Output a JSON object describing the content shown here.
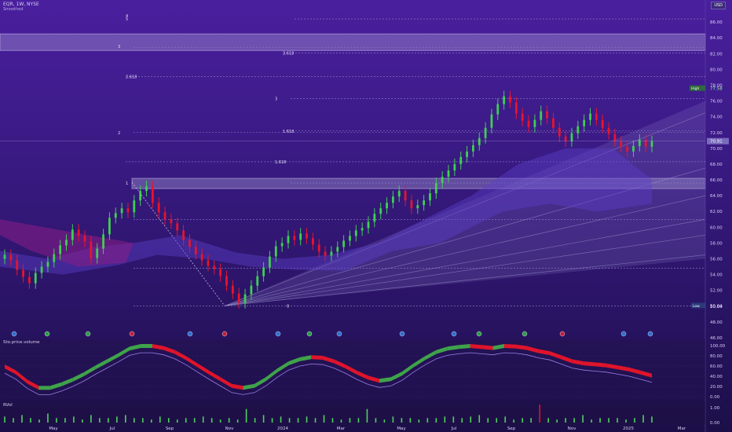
{
  "header": {
    "ticker": "EQR, 1W, NYSE",
    "subtitle": "Smoothed",
    "currency": "USD",
    "watermark": "EQR, 1W"
  },
  "colors": {
    "up": "#3fcf52",
    "down": "#e8142c",
    "neutral": "#b9b0d6",
    "fib_line": "#8f84c4",
    "gann_fan": "#a79fd1",
    "stoch_up": "#3fa34a",
    "stoch_down": "#e0142a"
  },
  "price_axis": {
    "min": 46,
    "max": 88,
    "ticks": [
      "86.00",
      "84.00",
      "82.00",
      "80.00",
      "78.00",
      "76.00",
      "74.00",
      "72.00",
      "70.00",
      "68.00",
      "66.00",
      "64.00",
      "62.00",
      "60.00",
      "58.00",
      "56.00",
      "54.00",
      "52.00",
      "50.00",
      "48.00",
      "46.00"
    ],
    "high_label": "High",
    "high_value": "77.58",
    "current_value": "70.91",
    "low_label": "Low",
    "low_value": "50.04"
  },
  "fib_levels": [
    {
      "label": "0",
      "value": 50.04
    },
    {
      "label": "1",
      "value": 65.6
    },
    {
      "label": "1.618",
      "value": 68.3
    },
    {
      "label": "2",
      "value": 72.0
    },
    {
      "label": "1.618",
      "value": 72.2
    },
    {
      "label": "2.618",
      "value": 79.1
    },
    {
      "label": "3",
      "value": 76.3
    },
    {
      "label": "3",
      "value": 82.9
    },
    {
      "label": "3.618",
      "value": 82.1
    },
    {
      "label": "4",
      "value": 86.8
    },
    {
      "label": "5",
      "value": 86.4
    }
  ],
  "supply_zones": [
    {
      "from": 82.4,
      "to": 84.5
    },
    {
      "from": 64.9,
      "to": 66.2
    }
  ],
  "x_axis": {
    "labels": [
      "May",
      "Jul",
      "Sep",
      "Nov",
      "2024",
      "Mar",
      "May",
      "Jul",
      "Sep",
      "Nov",
      "2025",
      "Mar"
    ]
  },
  "stoch": {
    "label": "Sto.price.volume",
    "ticks": [
      "100.00",
      "80.00",
      "60.00",
      "40.00",
      "20.00",
      "0.00"
    ],
    "values": [
      60,
      48,
      30,
      18,
      18,
      25,
      34,
      45,
      58,
      70,
      82,
      95,
      100,
      100,
      96,
      88,
      76,
      62,
      48,
      35,
      22,
      18,
      22,
      35,
      52,
      66,
      74,
      78,
      77,
      70,
      60,
      48,
      38,
      32,
      35,
      46,
      62,
      76,
      88,
      95,
      98,
      100,
      98,
      96,
      100,
      99,
      96,
      90,
      86,
      78,
      70,
      66,
      64,
      62,
      58,
      54,
      48,
      42
    ]
  },
  "volume": {
    "label": "RVol",
    "ticks": [
      "1.00",
      "0.00"
    ],
    "values": [
      0.4,
      0.3,
      0.5,
      0.3,
      0.2,
      0.6,
      0.3,
      0.3,
      0.4,
      0.2,
      0.5,
      0.3,
      0.3,
      0.4,
      0.5,
      0.3,
      0.3,
      0.2,
      0.4,
      0.3,
      0.2,
      0.3,
      0.3,
      0.4,
      0.3,
      0.2,
      0.3,
      0.2,
      0.9,
      0.3,
      0.5,
      0.3,
      0.4,
      0.3,
      0.3,
      0.4,
      0.3,
      0.5,
      0.3,
      0.2,
      0.3,
      0.3,
      0.9,
      0.3,
      0.2,
      0.4,
      0.3,
      0.3,
      0.2,
      0.3,
      0.3,
      0.4,
      0.4,
      0.3,
      0.4,
      0.5,
      0.3,
      0.3,
      0.4,
      0.2,
      0.3,
      0.3,
      1.2,
      0.3,
      0.2,
      0.3,
      0.3,
      0.5,
      0.2,
      0.3,
      0.3,
      0.3,
      0.2,
      0.3,
      0.5,
      0.4
    ]
  },
  "chart_data": {
    "type": "candlestick",
    "title": "EQR, 1W, NYSE",
    "series": [
      {
        "name": "EQR",
        "close": [
          56.5,
          55.8,
          54.6,
          53.7,
          52.9,
          54.2,
          55.0,
          55.6,
          56.6,
          57.7,
          58.4,
          59.7,
          58.9,
          58.2,
          56.1,
          57.3,
          59.1,
          61.2,
          61.8,
          62.4,
          61.9,
          63.4,
          64.6,
          65.2,
          63.1,
          61.9,
          61.0,
          60.5,
          59.6,
          58.4,
          57.5,
          56.6,
          55.8,
          55.1,
          54.7,
          53.8,
          52.6,
          51.6,
          50.4,
          51.5,
          52.6,
          53.8,
          54.9,
          56.3,
          57.6,
          58.0,
          58.9,
          58.4,
          59.2,
          58.6,
          57.8,
          56.9,
          56.4,
          56.9,
          57.5,
          58.3,
          58.9,
          59.6,
          59.9,
          60.7,
          61.7,
          62.4,
          63.1,
          63.9,
          64.6,
          63.4,
          62.4,
          62.8,
          63.4,
          64.3,
          65.6,
          66.4,
          67.2,
          68.0,
          68.9,
          69.6,
          70.4,
          71.3,
          72.6,
          74.3,
          75.6,
          76.6,
          75.8,
          74.4,
          73.5,
          72.7,
          73.6,
          74.7,
          73.8,
          72.6,
          71.5,
          70.9,
          71.9,
          72.8,
          73.6,
          74.4,
          73.6,
          72.6,
          71.8,
          70.9,
          70.2,
          69.6,
          70.3,
          71.1,
          70.2,
          70.9
        ]
      }
    ],
    "xlabels": [
      "May",
      "Jul",
      "Sep",
      "Nov",
      "2024",
      "Mar",
      "May",
      "Jul",
      "Sep",
      "Nov",
      "2025",
      "Mar"
    ],
    "ylim": [
      46,
      88
    ]
  }
}
